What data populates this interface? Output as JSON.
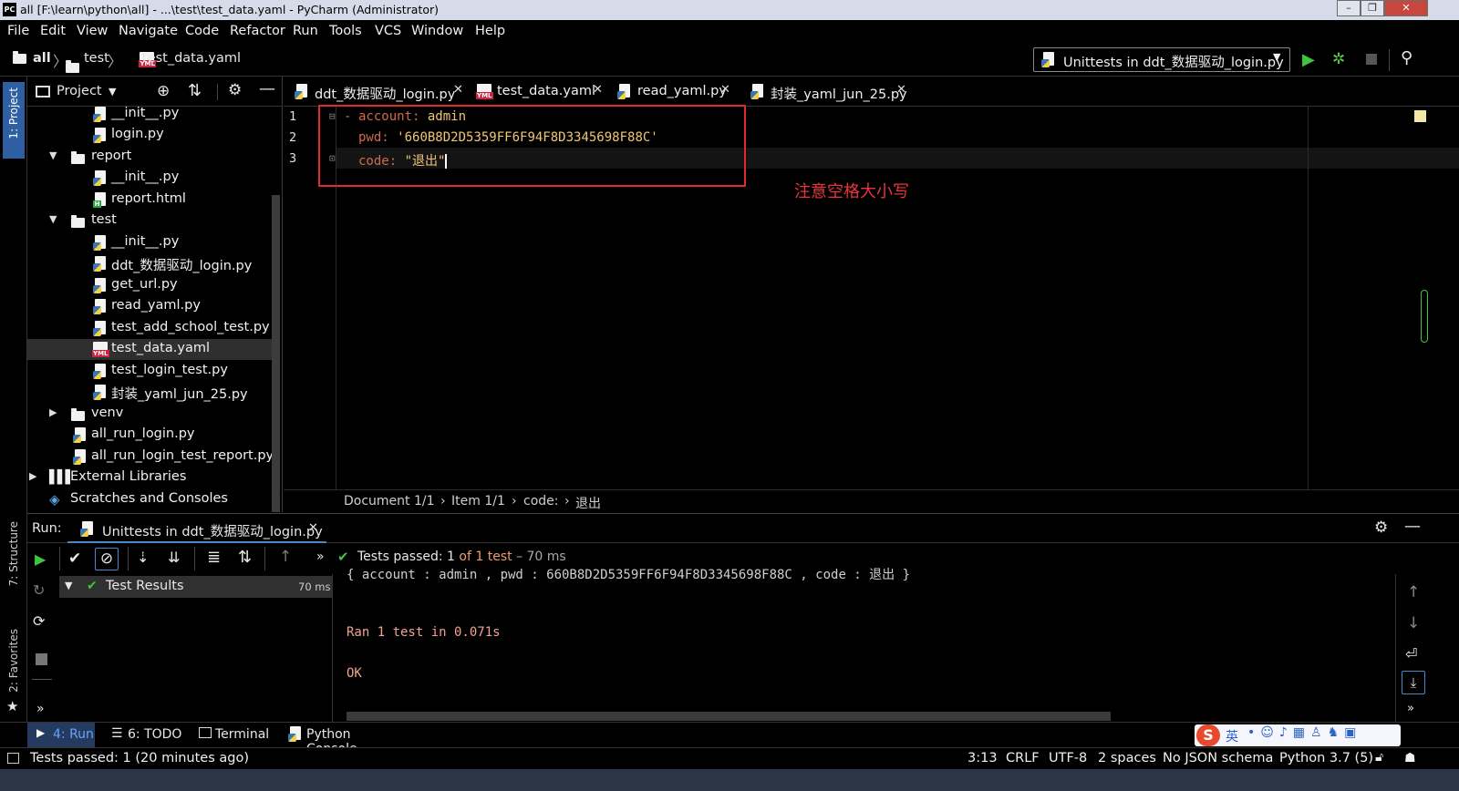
{
  "window": {
    "app_icon": "PC",
    "title": "all [F:\\learn\\python\\all] - ...\\test\\test_data.yaml - PyCharm (Administrator)",
    "controls": [
      "–",
      "❐",
      "✕"
    ]
  },
  "menu": [
    "File",
    "Edit",
    "View",
    "Navigate",
    "Code",
    "Refactor",
    "Run",
    "Tools",
    "VCS",
    "Window",
    "Help"
  ],
  "breadcrumb": [
    "all",
    "test",
    "test_data.yaml"
  ],
  "run_config": {
    "label": "Unittests in ddt_数据驱动_login.py"
  },
  "left_strip": {
    "project": "1: Project",
    "structure": "7: Structure",
    "favorites": "2: Favorites"
  },
  "project_panel": {
    "title": "Project",
    "tree": [
      {
        "label": "__init__.py",
        "icon": "python-file-icon"
      },
      {
        "label": "login.py",
        "icon": "python-file-icon"
      },
      {
        "label": "report",
        "icon": "folder-icon"
      },
      {
        "label": "__init__.py",
        "icon": "python-file-icon"
      },
      {
        "label": "report.html",
        "icon": "html-file-icon"
      },
      {
        "label": "test",
        "icon": "folder-icon"
      },
      {
        "label": "__init__.py",
        "icon": "python-file-icon"
      },
      {
        "label": "ddt_数据驱动_login.py",
        "icon": "python-file-icon"
      },
      {
        "label": "get_url.py",
        "icon": "python-file-icon"
      },
      {
        "label": "read_yaml.py",
        "icon": "python-file-icon"
      },
      {
        "label": "test_add_school_test.py",
        "icon": "python-file-icon"
      },
      {
        "label": "test_data.yaml",
        "icon": "yaml-file-icon"
      },
      {
        "label": "test_login_test.py",
        "icon": "python-file-icon"
      },
      {
        "label": "封装_yaml_jun_25.py",
        "icon": "python-file-icon"
      },
      {
        "label": "venv",
        "icon": "folder-icon"
      },
      {
        "label": "all_run_login.py",
        "icon": "python-file-icon"
      },
      {
        "label": "all_run_login_test_report.py",
        "icon": "python-file-icon"
      },
      {
        "label": "External Libraries",
        "icon": "libraries-icon"
      },
      {
        "label": "Scratches and Consoles",
        "icon": "scratches-icon"
      }
    ]
  },
  "editor_tabs": [
    {
      "label": "ddt_数据驱动_login.py",
      "icon": "python-file-icon",
      "active": false
    },
    {
      "label": "test_data.yaml",
      "icon": "yaml-file-icon",
      "active": true
    },
    {
      "label": "read_yaml.py",
      "icon": "python-file-icon",
      "active": false
    },
    {
      "label": "封装_yaml_jun_25.py",
      "icon": "python-file-icon",
      "active": false
    }
  ],
  "editor": {
    "line_numbers": [
      "1",
      "2",
      "3"
    ],
    "lines": [
      {
        "key": "account:",
        "value": "admin"
      },
      {
        "key": "pwd:",
        "value": "'660B8D2D5359FF6F94F8D3345698F88C'"
      },
      {
        "key": "code:",
        "value": "\"退出\""
      }
    ],
    "annotation": "注意空格大小写",
    "breadcrumb": [
      "Document 1/1",
      "Item 1/1",
      "code:",
      "退出"
    ]
  },
  "run_panel": {
    "label": "Run:",
    "tab": "Unittests in ddt_数据驱动_login.py",
    "status_prefix": "Tests passed:",
    "status_count": "1",
    "status_of": "of 1 test",
    "status_time": "– 70 ms",
    "results_label": "Test Results",
    "results_time": "70 ms",
    "console_truncated": "{ account : admin , pwd : 660B8D2D5359FF6F94F8D3345698F88C , code : 退出 }",
    "console": [
      "Ran 1 test in 0.071s",
      "OK"
    ]
  },
  "tool_tabs": [
    {
      "label": "4: Run",
      "icon": "run-icon",
      "active": true
    },
    {
      "label": "6: TODO",
      "icon": "todo-icon",
      "active": false
    },
    {
      "label": "Terminal",
      "icon": "terminal-icon",
      "active": false
    },
    {
      "label": "Python Console",
      "icon": "python-console-icon",
      "active": false
    }
  ],
  "ime": {
    "label": "英"
  },
  "status_bar": {
    "message": "Tests passed: 1 (20 minutes ago)",
    "position": "3:13",
    "line_sep": "CRLF",
    "encoding": "UTF-8",
    "indent": "2 spaces",
    "schema": "No JSON schema",
    "interpreter": "Python 3.7 (5)"
  },
  "colors": {
    "accent": "#4a88c7",
    "pass_green": "#3fc43f",
    "annotation_red": "#e02a2a",
    "yaml_key": "#cf6a4c",
    "yaml_string": "#f0c674"
  }
}
